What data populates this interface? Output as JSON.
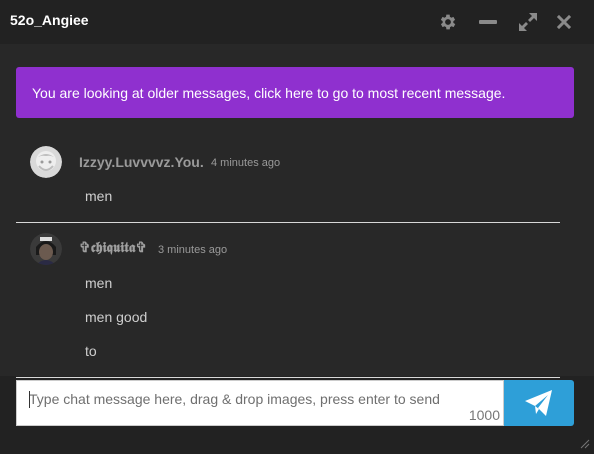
{
  "window": {
    "title": "52o_Angiee",
    "buttons": [
      "gear-icon",
      "minimize-icon",
      "expand-icon",
      "close-icon"
    ]
  },
  "banner": {
    "text": "You are looking at older messages, click here to go to most recent message.",
    "color": "#8f30cf"
  },
  "messages": [
    {
      "user": "Izzyy.Luvvvvz.You.",
      "time": "4 minutes ago",
      "lines": [
        "men"
      ]
    },
    {
      "user": "✞𝖈𝖍𝖎𝖖𝖚𝖎𝖙𝖆✞",
      "time": "3 minutes ago",
      "lines": [
        "men",
        "men good",
        "to"
      ]
    }
  ],
  "composer": {
    "placeholder": "Type chat message here, drag & drop images, press enter to send",
    "value": "",
    "remaining_chars": "1000",
    "send_icon": "paper-plane-icon",
    "accent": "#2e9fd8"
  }
}
